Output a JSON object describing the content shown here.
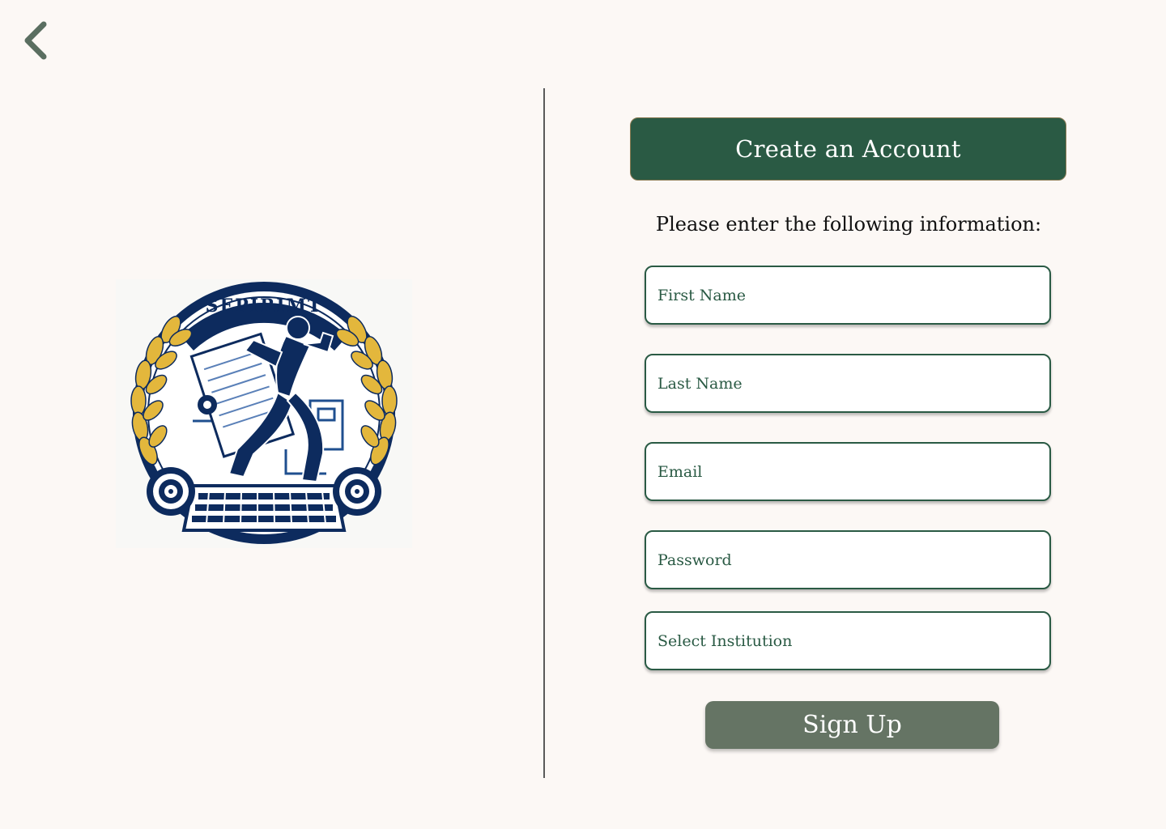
{
  "header": {
    "back_icon": "chevron-left-icon",
    "title": "Create an Account"
  },
  "logo": {
    "text": "SEPIRIMT",
    "icon": "emblem-logo"
  },
  "form": {
    "instructions": "Please enter the following information:",
    "first_name_placeholder": "First Name",
    "last_name_placeholder": "Last Name",
    "email_placeholder": "Email",
    "password_placeholder": "Password",
    "institution_placeholder": "Select Institution",
    "submit_label": "Sign Up"
  },
  "colors": {
    "background": "#fcf8f5",
    "primary": "#2a5a44",
    "button": "#657464",
    "logo_navy": "#0d2b5e",
    "logo_gold": "#e3b73c"
  }
}
